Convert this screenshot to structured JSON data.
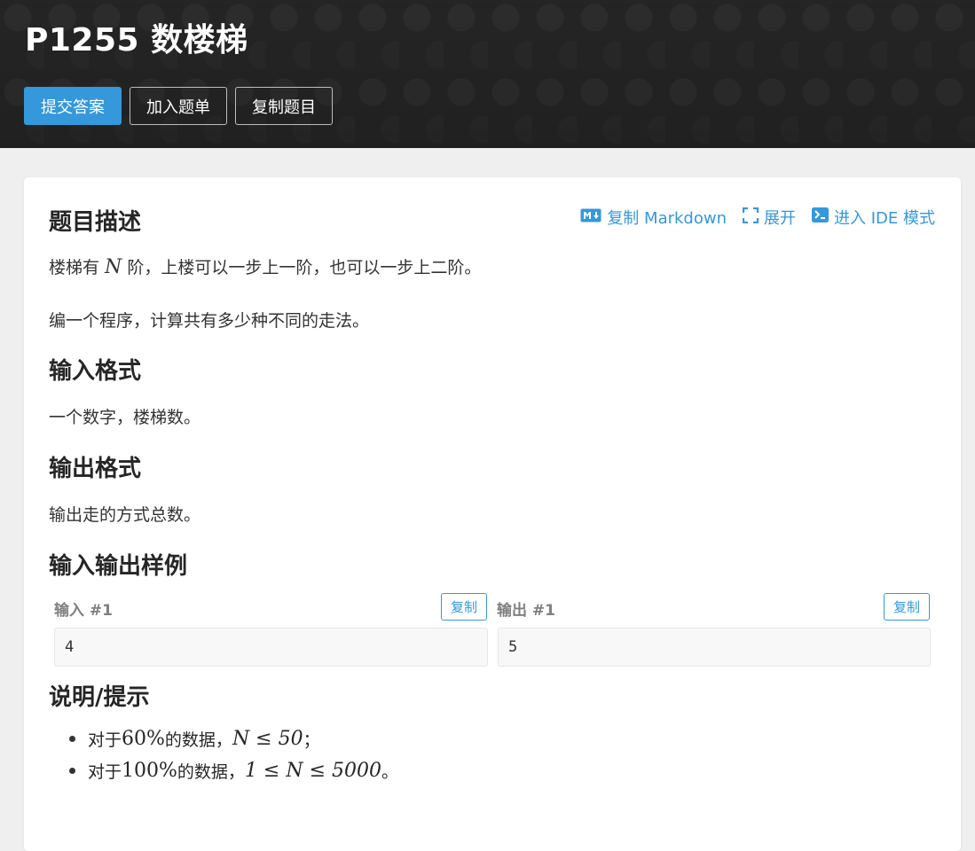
{
  "header": {
    "title": "P1255 数楼梯",
    "buttons": [
      "提交答案",
      "加入题单",
      "复制题目"
    ]
  },
  "toolbar": {
    "copy_markdown": "复制 Markdown",
    "expand": "展开",
    "ide_mode": "进入 IDE 模式",
    "icons": [
      "markdown-icon",
      "expand-icon",
      "terminal-icon"
    ],
    "accent_color": "#3498db"
  },
  "sections": {
    "description": {
      "heading": "题目描述",
      "line1_pre": "楼梯有 ",
      "line1_var": "N",
      "line1_post": " 阶，上楼可以一步上一阶，也可以一步上二阶。",
      "line2": "编一个程序，计算共有多少种不同的走法。"
    },
    "input_format": {
      "heading": "输入格式",
      "text": "一个数字，楼梯数。"
    },
    "output_format": {
      "heading": "输出格式",
      "text": "输出走的方式总数。"
    },
    "samples": {
      "heading": "输入输出样例",
      "input_label": "输入 #1",
      "output_label": "输出 #1",
      "copy_label": "复制",
      "input_value": "4",
      "output_value": "5"
    },
    "hints": {
      "heading": "说明/提示",
      "item1": {
        "pre": "对于 ",
        "pct": "60%",
        "mid": " 的数据，",
        "math": "N ≤ 50",
        "post": "；"
      },
      "item2": {
        "pre": "对于 ",
        "pct": "100%",
        "mid": " 的数据，",
        "math": "1 ≤ N ≤ 5000",
        "post": "。"
      }
    }
  }
}
